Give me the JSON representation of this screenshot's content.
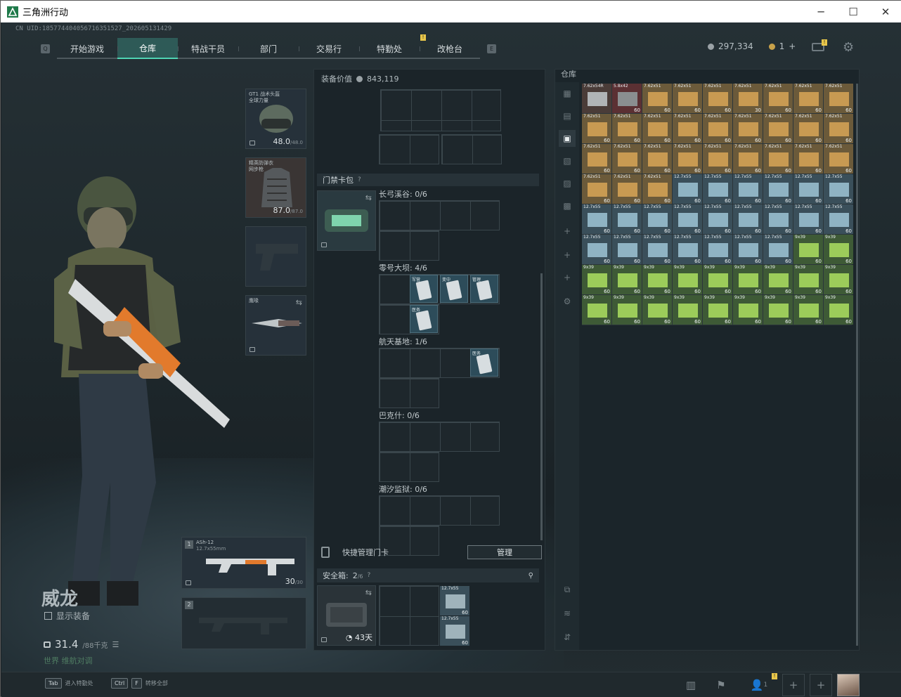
{
  "window": {
    "title": "三角洲行动",
    "minimize": "─",
    "maximize": "☐",
    "close": "✕"
  },
  "uid": "CN UID:1857744040567163515​27_202605131429",
  "nav": {
    "tabs": [
      "开始游戏",
      "仓库",
      "特战干员",
      "部门",
      "交易行",
      "特勤处",
      "改枪台"
    ],
    "active_index": 1,
    "left_key": "Q",
    "right_key": "E",
    "badge": "!"
  },
  "currency": {
    "coins": "297,334",
    "tickets": "1",
    "plus": "+",
    "mail_badge": "!"
  },
  "character": {
    "name": "威龙",
    "show_equip_label": "显示装备",
    "weight": "31.4",
    "weight_max": "/88千克",
    "world_label": "世界",
    "world_text": "维航对调"
  },
  "equipment": {
    "helmet": {
      "label": "GT1 战术头盔\n全球力量",
      "durability": "48.0",
      "max": "/48.0"
    },
    "armor": {
      "label": "精英防弹衣\n网步枪",
      "durability": "87.0",
      "max": "/87.0"
    },
    "pistol": {
      "label": ""
    },
    "melee": {
      "label": "鹰喙",
      "swap": "⇆"
    },
    "primary": {
      "slot": "1",
      "name": "ASh-12",
      "caliber": "12.7x55mm",
      "ammo": "30",
      "ammo_max": "/30"
    },
    "secondary": {
      "slot": "2"
    }
  },
  "middle": {
    "equip_value_label": "装备价值",
    "equip_value": "843,119",
    "keycard_section": "门禁卡包",
    "help": "?",
    "maps": [
      {
        "name": "长弓溪谷: 0/6",
        "cards": []
      },
      {
        "name": "零号大坝: 4/6",
        "cards": [
          "军营",
          "变中",
          "管理",
          "医务"
        ]
      },
      {
        "name": "航天基地: 1/6",
        "cards": [
          "医务"
        ]
      },
      {
        "name": "巴克什: 0/6",
        "cards": []
      },
      {
        "name": "潮汐监狱: 0/6",
        "cards": []
      }
    ],
    "quick_manage": "快捷管理门卡",
    "manage_btn": "管理",
    "safebox_label": "安全箱:",
    "safebox_count": "2",
    "safebox_max": "/6",
    "safebox_timer": "43天",
    "safebox_items": [
      {
        "name": "12.7x55",
        "qty": "60"
      },
      {
        "name": "12.7x55",
        "qty": "60"
      }
    ]
  },
  "warehouse": {
    "title": "仓库",
    "items": [
      {
        "n": "7.62x54R",
        "q": "",
        "t": "gray"
      },
      {
        "n": "5.8x42",
        "q": "60",
        "t": "red"
      },
      {
        "n": "7.62x51",
        "q": "60",
        "t": "tan"
      },
      {
        "n": "7.62x51",
        "q": "60",
        "t": "tan"
      },
      {
        "n": "7.62x51",
        "q": "60",
        "t": "tan"
      },
      {
        "n": "7.62x51",
        "q": "30",
        "t": "tan"
      },
      {
        "n": "7.62x51",
        "q": "60",
        "t": "tan"
      },
      {
        "n": "7.62x51",
        "q": "60",
        "t": "tan"
      },
      {
        "n": "7.62x51",
        "q": "60",
        "t": "tan"
      },
      {
        "n": "7.62x51",
        "q": "60",
        "t": "tan"
      },
      {
        "n": "7.62x51",
        "q": "60",
        "t": "tan"
      },
      {
        "n": "7.62x51",
        "q": "60",
        "t": "tan"
      },
      {
        "n": "7.62x51",
        "q": "60",
        "t": "tan"
      },
      {
        "n": "7.62x51",
        "q": "60",
        "t": "tan"
      },
      {
        "n": "7.62x51",
        "q": "60",
        "t": "tan"
      },
      {
        "n": "7.62x51",
        "q": "60",
        "t": "tan"
      },
      {
        "n": "7.62x51",
        "q": "60",
        "t": "tan"
      },
      {
        "n": "7.62x51",
        "q": "60",
        "t": "tan"
      },
      {
        "n": "7.62x51",
        "q": "60",
        "t": "tan"
      },
      {
        "n": "7.62x51",
        "q": "60",
        "t": "tan"
      },
      {
        "n": "7.62x51",
        "q": "60",
        "t": "tan"
      },
      {
        "n": "7.62x51",
        "q": "60",
        "t": "tan"
      },
      {
        "n": "7.62x51",
        "q": "60",
        "t": "tan"
      },
      {
        "n": "7.62x51",
        "q": "60",
        "t": "tan"
      },
      {
        "n": "7.62x51",
        "q": "60",
        "t": "tan"
      },
      {
        "n": "7.62x51",
        "q": "60",
        "t": "tan"
      },
      {
        "n": "7.62x51",
        "q": "60",
        "t": "tan"
      },
      {
        "n": "7.62x51",
        "q": "60",
        "t": "tan"
      },
      {
        "n": "7.62x51",
        "q": "60",
        "t": "tan"
      },
      {
        "n": "7.62x51",
        "q": "60",
        "t": "tan"
      },
      {
        "n": "12.7x55",
        "q": "60",
        "t": "blue"
      },
      {
        "n": "12.7x55",
        "q": "60",
        "t": "blue"
      },
      {
        "n": "12.7x55",
        "q": "60",
        "t": "blue"
      },
      {
        "n": "12.7x55",
        "q": "60",
        "t": "blue"
      },
      {
        "n": "12.7x55",
        "q": "60",
        "t": "blue"
      },
      {
        "n": "12.7x55",
        "q": "60",
        "t": "blue"
      },
      {
        "n": "12.7x55",
        "q": "60",
        "t": "blue"
      },
      {
        "n": "12.7x55",
        "q": "60",
        "t": "blue"
      },
      {
        "n": "12.7x55",
        "q": "60",
        "t": "blue"
      },
      {
        "n": "12.7x55",
        "q": "60",
        "t": "blue"
      },
      {
        "n": "12.7x55",
        "q": "60",
        "t": "blue"
      },
      {
        "n": "12.7x55",
        "q": "60",
        "t": "blue"
      },
      {
        "n": "12.7x55",
        "q": "60",
        "t": "blue"
      },
      {
        "n": "12.7x55",
        "q": "60",
        "t": "blue"
      },
      {
        "n": "12.7x55",
        "q": "60",
        "t": "blue"
      },
      {
        "n": "12.7x55",
        "q": "60",
        "t": "blue"
      },
      {
        "n": "12.7x55",
        "q": "60",
        "t": "blue"
      },
      {
        "n": "12.7x55",
        "q": "60",
        "t": "blue"
      },
      {
        "n": "12.7x55",
        "q": "60",
        "t": "blue"
      },
      {
        "n": "12.7x55",
        "q": "60",
        "t": "blue"
      },
      {
        "n": "12.7x55",
        "q": "60",
        "t": "blue"
      },
      {
        "n": "12.7x55",
        "q": "60",
        "t": "blue"
      },
      {
        "n": "9x39",
        "q": "60",
        "t": "green"
      },
      {
        "n": "9x39",
        "q": "60",
        "t": "green"
      },
      {
        "n": "9x39",
        "q": "60",
        "t": "green"
      },
      {
        "n": "9x39",
        "q": "60",
        "t": "green"
      },
      {
        "n": "9x39",
        "q": "60",
        "t": "green"
      },
      {
        "n": "9x39",
        "q": "60",
        "t": "green"
      },
      {
        "n": "9x39",
        "q": "60",
        "t": "green"
      },
      {
        "n": "9x39",
        "q": "60",
        "t": "green"
      },
      {
        "n": "9x39",
        "q": "60",
        "t": "green"
      },
      {
        "n": "9x39",
        "q": "60",
        "t": "green"
      },
      {
        "n": "9x39",
        "q": "60",
        "t": "green"
      },
      {
        "n": "9x39",
        "q": "60",
        "t": "green"
      },
      {
        "n": "9x39",
        "q": "60",
        "t": "green"
      },
      {
        "n": "9x39",
        "q": "60",
        "t": "green"
      },
      {
        "n": "9x39",
        "q": "60",
        "t": "green"
      },
      {
        "n": "9x39",
        "q": "60",
        "t": "green"
      },
      {
        "n": "9x39",
        "q": "60",
        "t": "green"
      },
      {
        "n": "9x39",
        "q": "60",
        "t": "green"
      },
      {
        "n": "9x39",
        "q": "60",
        "t": "green"
      },
      {
        "n": "9x39",
        "q": "60",
        "t": "green"
      }
    ],
    "colors": {
      "tan": "#6b5a3a",
      "red": "#5b3033",
      "gray": "#4a3c38",
      "blue": "#3a4f5a",
      "green": "#3e5a36"
    }
  },
  "bottom": {
    "hint1_key": "Tab",
    "hint1": "进入特勤处",
    "hint2_key1": "Ctrl",
    "hint2_key2": "F",
    "hint2": "转移全部",
    "friends": "1",
    "badge": "!"
  }
}
